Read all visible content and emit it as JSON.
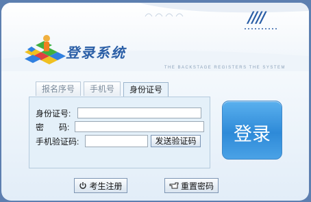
{
  "header": {
    "title": "登录系统",
    "subtitle": "THE BACKSTAGE REGISTERS THE SYSTEM"
  },
  "tabs": [
    {
      "label": "报名序号",
      "active": false
    },
    {
      "label": "手机号",
      "active": false
    },
    {
      "label": "身份证号",
      "active": true
    }
  ],
  "form": {
    "id_label": "身份证号:",
    "id_value": "",
    "password_label_1": "密",
    "password_label_2": "码:",
    "password_value": "",
    "phone_code_label": "手机验证码:",
    "phone_code_value": "",
    "send_code_button": "发送验证码"
  },
  "login_button": "登录",
  "footer": {
    "register_button": "考生注册",
    "reset_password_button": "重置密码"
  },
  "icons": {
    "register": "power-icon",
    "reset": "hand-pointer-icon",
    "logo": "colorful-blocks-logo-icon"
  },
  "colors": {
    "accent": "#2a5ea6",
    "login_button": "#3a96e0",
    "form_background": "#e4f0f9"
  }
}
